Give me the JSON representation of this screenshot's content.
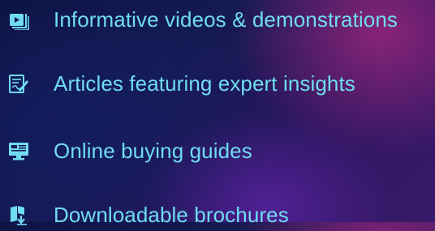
{
  "accent_color": "#6fdcf0",
  "items": [
    {
      "label": "Informative videos & demonstrations",
      "icon": "video-playlist-icon"
    },
    {
      "label": "Articles featuring expert insights",
      "icon": "article-pen-icon"
    },
    {
      "label": "Online buying guides",
      "icon": "computer-monitor-icon"
    },
    {
      "label": "Downloadable brochures",
      "icon": "brochure-download-icon"
    }
  ]
}
